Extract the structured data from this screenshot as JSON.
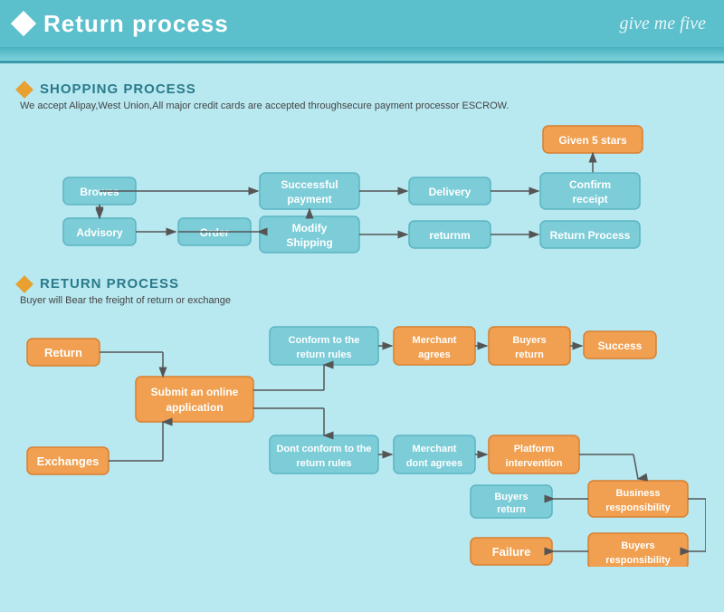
{
  "header": {
    "title": "Return process",
    "brand": "give me five",
    "diamond_color": "#ffffff"
  },
  "shopping": {
    "section_title": "SHOPPING PROCESS",
    "description": "We accept Alipay,West Union,All major credit cards are accepted throughsecure payment processor ESCROW.",
    "nodes": {
      "browes": "Browes",
      "order": "Order",
      "advisory": "Advisory",
      "modify_shipping": "Modify\nShipping",
      "successful_payment": "Successful\npayment",
      "delivery": "Delivery",
      "confirm_receipt": "Confirm\nreceipt",
      "given_5_stars": "Given 5 stars",
      "returnm": "returnm",
      "return_process": "Return Process"
    }
  },
  "return_process": {
    "section_title": "RETURN PROCESS",
    "description": "Buyer will Bear the freight of return or exchange",
    "nodes": {
      "return": "Return",
      "exchanges": "Exchanges",
      "submit_online": "Submit an online\napplication",
      "conform_rules": "Conform to the\nreturn rules",
      "dont_conform_rules": "Dont conform to the\nreturn rules",
      "merchant_agrees": "Merchant\nagrees",
      "merchant_dont_agrees": "Merchant\ndont agrees",
      "buyers_return_1": "Buyers\nreturn",
      "buyers_return_2": "Buyers\nreturn",
      "platform_intervention": "Platform\nintervention",
      "success": "Success",
      "business_responsibility": "Business\nresponsibility",
      "buyers_responsibility": "Buyers\nresponsibility",
      "failure": "Failure"
    }
  }
}
